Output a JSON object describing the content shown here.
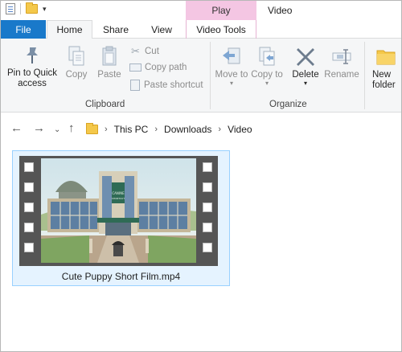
{
  "titlebar": {
    "context_tab": "Play",
    "window_title": "Video"
  },
  "tabs": {
    "file": "File",
    "home": "Home",
    "share": "Share",
    "view": "View",
    "video_tools": "Video Tools"
  },
  "ribbon": {
    "pin_label": "Pin to Quick access",
    "copy_label": "Copy",
    "paste_label": "Paste",
    "cut_label": "Cut",
    "copy_path_label": "Copy path",
    "paste_shortcut_label": "Paste shortcut",
    "clipboard_group": "Clipboard",
    "move_to_label": "Move to",
    "copy_to_label": "Copy to",
    "delete_label": "Delete",
    "rename_label": "Rename",
    "organize_group": "Organize",
    "new_folder_label": "New folder"
  },
  "address": {
    "crumbs": [
      "This PC",
      "Downloads",
      "Video"
    ]
  },
  "files": [
    {
      "name": "Cute Puppy Short Film.mp4",
      "thumbnail_text": "CANINE SHORTCUT"
    }
  ]
}
